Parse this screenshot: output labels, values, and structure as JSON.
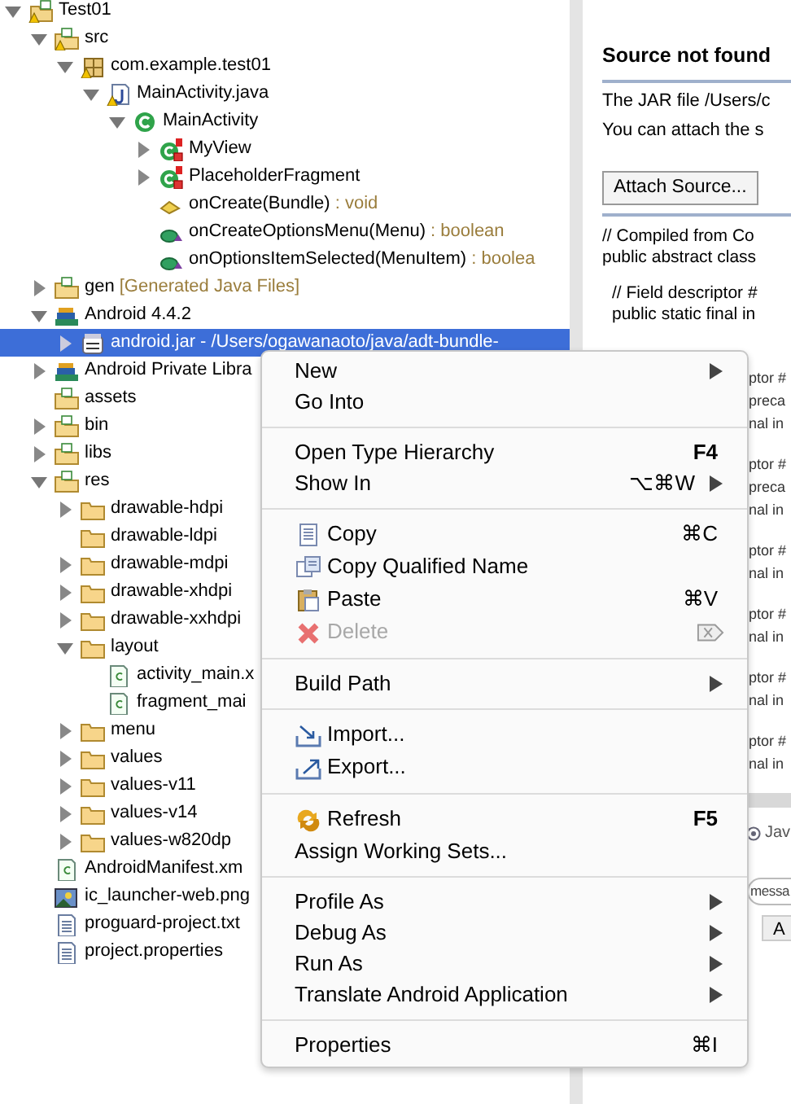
{
  "tree": [
    {
      "label": "Test01",
      "kind": "project",
      "warning": true,
      "expanded": true,
      "selected": false,
      "children": [
        {
          "label": "src",
          "kind": "source-folder",
          "warning": true,
          "expanded": true,
          "selected": false,
          "children": [
            {
              "label": "com.example.test01",
              "kind": "package",
              "warning": true,
              "expanded": true,
              "selected": false,
              "children": [
                {
                  "label": "MainActivity.java",
                  "kind": "java-file",
                  "warning": true,
                  "expanded": true,
                  "selected": false,
                  "children": [
                    {
                      "label": "MainActivity",
                      "kind": "class",
                      "expanded": true,
                      "selected": false,
                      "children": [
                        {
                          "label": "MyView",
                          "kind": "inner-class",
                          "expanded": false,
                          "selected": false
                        },
                        {
                          "label": "PlaceholderFragment",
                          "kind": "inner-class",
                          "expanded": false,
                          "selected": false
                        },
                        {
                          "label": "onCreate(Bundle)",
                          "detail": ": void",
                          "kind": "protected-method",
                          "selected": false
                        },
                        {
                          "label": "onCreateOptionsMenu(Menu)",
                          "detail": ": boolean",
                          "kind": "public-method",
                          "selected": false
                        },
                        {
                          "label": "onOptionsItemSelected(MenuItem)",
                          "detail": ": boolea",
                          "kind": "public-method",
                          "selected": false
                        }
                      ]
                    }
                  ]
                }
              ]
            }
          ]
        },
        {
          "label": "gen",
          "detail": "[Generated Java Files]",
          "kind": "source-folder",
          "expanded": false,
          "selected": false
        },
        {
          "label": "Android 4.4.2",
          "kind": "library",
          "expanded": true,
          "selected": false,
          "children": [
            {
              "label": "android.jar",
              "detail": "- /Users/ogawanaoto/java/adt-bundle-",
              "kind": "jar",
              "expanded": false,
              "selected": true
            }
          ]
        },
        {
          "label": "Android Private Libra",
          "kind": "library",
          "expanded": false,
          "selected": false
        },
        {
          "label": "assets",
          "kind": "source-folder",
          "selected": false
        },
        {
          "label": "bin",
          "kind": "source-folder",
          "expanded": false,
          "selected": false
        },
        {
          "label": "libs",
          "kind": "source-folder",
          "expanded": false,
          "selected": false
        },
        {
          "label": "res",
          "kind": "source-folder",
          "expanded": true,
          "selected": false,
          "children": [
            {
              "label": "drawable-hdpi",
              "kind": "folder",
              "expanded": false,
              "selected": false
            },
            {
              "label": "drawable-ldpi",
              "kind": "folder",
              "selected": false
            },
            {
              "label": "drawable-mdpi",
              "kind": "folder",
              "expanded": false,
              "selected": false
            },
            {
              "label": "drawable-xhdpi",
              "kind": "folder",
              "expanded": false,
              "selected": false
            },
            {
              "label": "drawable-xxhdpi",
              "kind": "folder",
              "expanded": false,
              "selected": false
            },
            {
              "label": "layout",
              "kind": "folder",
              "expanded": true,
              "selected": false,
              "children": [
                {
                  "label": "activity_main.x",
                  "kind": "xml-file",
                  "selected": false
                },
                {
                  "label": "fragment_mai",
                  "kind": "xml-file",
                  "selected": false
                }
              ]
            },
            {
              "label": "menu",
              "kind": "folder",
              "expanded": false,
              "selected": false
            },
            {
              "label": "values",
              "kind": "folder",
              "expanded": false,
              "selected": false
            },
            {
              "label": "values-v11",
              "kind": "folder",
              "expanded": false,
              "selected": false
            },
            {
              "label": "values-v14",
              "kind": "folder",
              "expanded": false,
              "selected": false
            },
            {
              "label": "values-w820dp",
              "kind": "folder",
              "expanded": false,
              "selected": false
            }
          ]
        },
        {
          "label": "AndroidManifest.xm",
          "kind": "xml-file",
          "selected": false
        },
        {
          "label": "ic_launcher-web.png",
          "kind": "image-file",
          "selected": false
        },
        {
          "label": "proguard-project.txt",
          "kind": "text-file",
          "selected": false
        },
        {
          "label": "project.properties",
          "kind": "text-file",
          "selected": false
        }
      ]
    }
  ],
  "editor": {
    "title": "Source not found",
    "lines": [
      "The JAR file /Users/c",
      "You can attach the s"
    ],
    "button": "Attach Source...",
    "code_groups": [
      [
        "// Compiled from Co",
        "public abstract class"
      ],
      [
        "// Field descriptor #",
        "public static final in"
      ]
    ],
    "fragments": [
      [
        "ptor #",
        "preca",
        "nal in"
      ],
      [
        "ptor #",
        "preca",
        "nal in"
      ],
      [
        "ptor #",
        "nal in"
      ],
      [
        "ptor #",
        "nal in"
      ],
      [
        "ptor #",
        "nal in"
      ],
      [
        "ptor #",
        "nal in"
      ]
    ]
  },
  "bottom_panel": {
    "tab": "Jav",
    "filter": "messa",
    "column": "A"
  },
  "menu": {
    "groups": [
      [
        {
          "label": "New",
          "submenu": true
        },
        {
          "label": "Go Into"
        }
      ],
      [
        {
          "label": "Open Type Hierarchy",
          "shortcut": "F4"
        },
        {
          "label": "Show In",
          "shortcut": "⌥⌘W",
          "submenu": true
        }
      ],
      [
        {
          "label": "Copy",
          "kind": "copy",
          "shortcut": "⌘C"
        },
        {
          "label": "Copy Qualified Name",
          "kind": "copy-name"
        },
        {
          "label": "Paste",
          "kind": "paste",
          "shortcut": "⌘V"
        },
        {
          "label": "Delete",
          "kind": "delete",
          "delete_key": true,
          "disabled": true
        }
      ],
      [
        {
          "label": "Build Path",
          "submenu": true
        }
      ],
      [
        {
          "label": "Import...",
          "kind": "import"
        },
        {
          "label": "Export...",
          "kind": "export"
        }
      ],
      [
        {
          "label": "Refresh",
          "kind": "refresh",
          "shortcut": "F5"
        },
        {
          "label": "Assign Working Sets..."
        }
      ],
      [
        {
          "label": "Profile As",
          "submenu": true
        },
        {
          "label": "Debug As",
          "submenu": true
        },
        {
          "label": "Run As",
          "submenu": true
        },
        {
          "label": "Translate Android Application",
          "submenu": true
        }
      ],
      [
        {
          "label": "Properties",
          "shortcut": "⌘I"
        }
      ]
    ]
  }
}
